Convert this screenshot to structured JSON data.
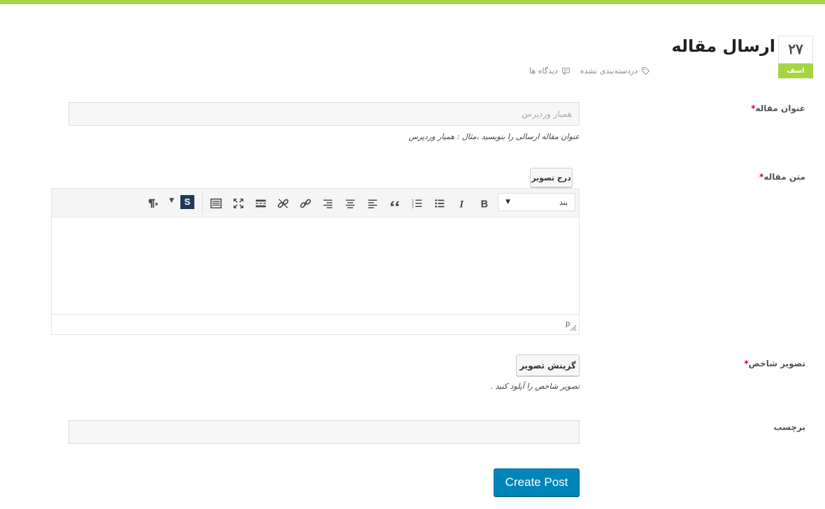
{
  "post": {
    "day": "۲۷",
    "month": "اسف",
    "title": "ارسال مقاله",
    "category": "دردسته‌بندی نشده",
    "comments": "دیدگاه ها"
  },
  "form": {
    "title_label": "عنوان مقاله",
    "required_mark": "*",
    "title_placeholder": "همیار وردپرس",
    "title_value": "",
    "title_hint": "عنوان مقاله ارسالی را بنویسید ،مثال : همیار وردپرس",
    "content_label": "متن مقاله",
    "insert_image_label": "درج تصویر",
    "format_select_value": "بند",
    "editor_path": "p",
    "featured_label": "تصویر شاخص",
    "choose_image_label": "گزینش تصویر",
    "featured_hint": "تصویر شاخص را آپلود کنید .",
    "tags_label": "برچسب",
    "tags_value": "",
    "submit_label": "Create Post"
  },
  "toolbar": {
    "buttons": [
      "bold-icon",
      "italic-icon",
      "bullet-list-icon",
      "numbered-list-icon",
      "blockquote-icon",
      "align-left-icon",
      "align-center-icon",
      "align-right-icon",
      "link-icon",
      "unlink-icon",
      "read-more-icon",
      "fullscreen-icon",
      "toolbar-toggle-icon"
    ],
    "s_badge": "S"
  },
  "colors": {
    "accent_green": "#a6d544",
    "button_blue": "#0085ba",
    "required_red": "#d0021b"
  }
}
